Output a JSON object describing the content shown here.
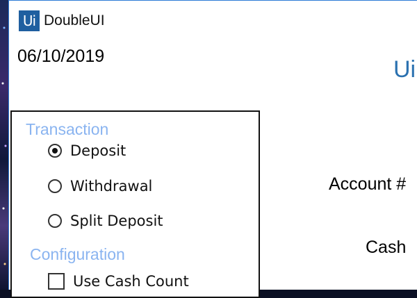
{
  "app": {
    "logo_text": "Ui",
    "title": "DoubleUI",
    "date": "06/10/2019",
    "brand_partial": "Ui"
  },
  "transaction": {
    "heading": "Transaction",
    "options": [
      {
        "label": "Deposit",
        "selected": true
      },
      {
        "label": "Withdrawal",
        "selected": false
      },
      {
        "label": "Split Deposit",
        "selected": false
      }
    ]
  },
  "configuration": {
    "heading": "Configuration",
    "use_cash_count_label": "Use Cash Count",
    "use_cash_count_checked": false
  },
  "form": {
    "account_label": "Account #",
    "cash_label": "Cash"
  },
  "colors": {
    "accent": "#2b7bd6",
    "logo_bg": "#1f5fa0",
    "heading": "#8ab4f0",
    "brand": "#2a71b0"
  }
}
